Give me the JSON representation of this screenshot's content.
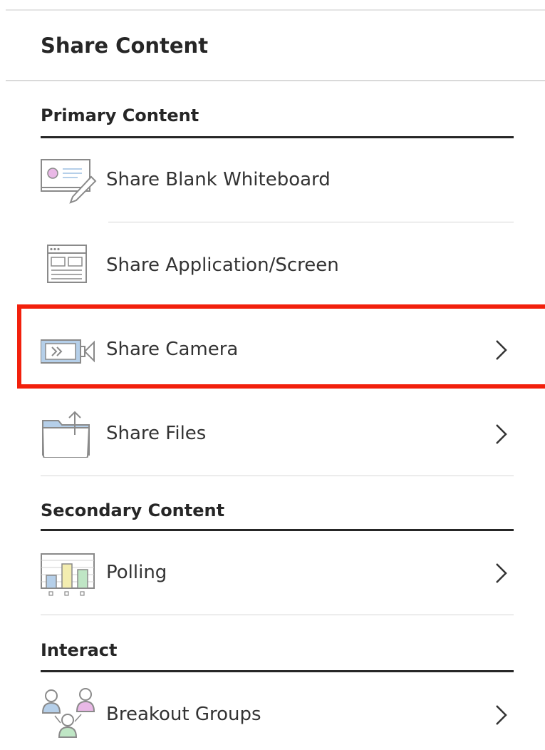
{
  "panel": {
    "title": "Share Content"
  },
  "sections": {
    "primary": {
      "title": "Primary Content",
      "items": [
        {
          "label": "Share Blank Whiteboard",
          "icon": "whiteboard-icon",
          "has_chevron": false
        },
        {
          "label": "Share Application/Screen",
          "icon": "application-screen-icon",
          "has_chevron": false
        },
        {
          "label": "Share Camera",
          "icon": "camera-icon",
          "has_chevron": true,
          "highlighted": true
        },
        {
          "label": "Share Files",
          "icon": "files-icon",
          "has_chevron": true
        }
      ]
    },
    "secondary": {
      "title": "Secondary Content",
      "items": [
        {
          "label": "Polling",
          "icon": "polling-chart-icon",
          "has_chevron": true
        }
      ]
    },
    "interact": {
      "title": "Interact",
      "items": [
        {
          "label": "Breakout Groups",
          "icon": "breakout-groups-icon",
          "has_chevron": true
        }
      ]
    }
  },
  "colors": {
    "highlight_border": "#f2200c",
    "text": "#262626",
    "divider": "#d6d6d6",
    "icon_stroke": "#8a8a8a",
    "icon_blue": "#b5cfe9",
    "icon_pink": "#e9b8e6",
    "icon_green": "#bfe6c5",
    "icon_yellow": "#f3edb0"
  }
}
